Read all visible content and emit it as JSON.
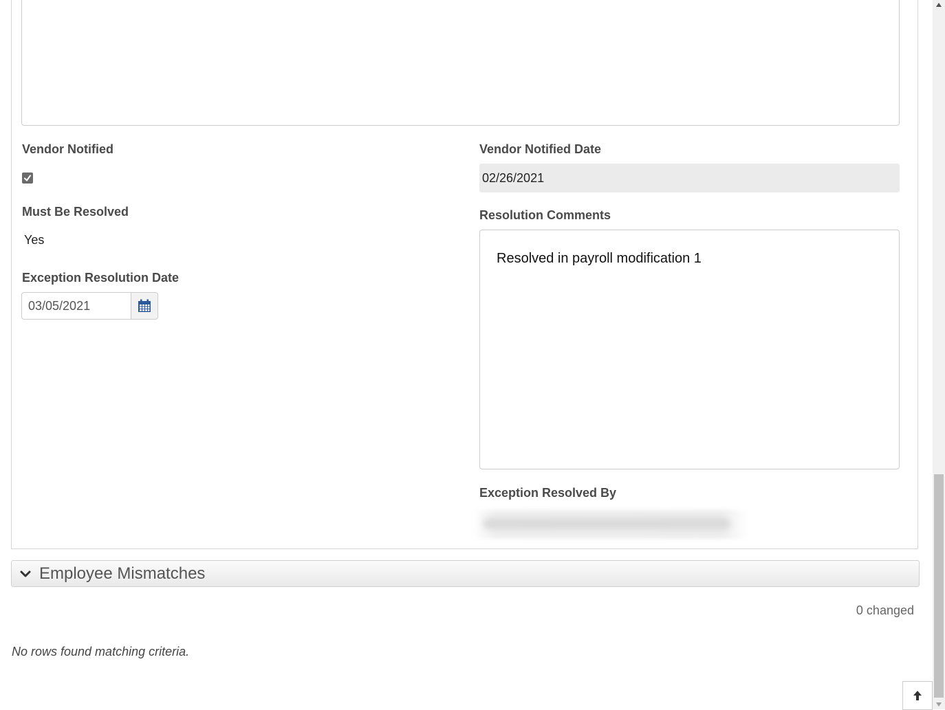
{
  "form": {
    "vendor_notified_label": "Vendor Notified",
    "vendor_notified_checked": true,
    "vendor_notified_date_label": "Vendor Notified Date",
    "vendor_notified_date_value": "02/26/2021",
    "must_be_resolved_label": "Must Be Resolved",
    "must_be_resolved_value": "Yes",
    "resolution_comments_label": "Resolution Comments",
    "resolution_comments_value": "Resolved in payroll modification 1",
    "exception_resolution_date_label": "Exception Resolution Date",
    "exception_resolution_date_value": "03/05/2021",
    "exception_resolved_by_label": "Exception Resolved By"
  },
  "section": {
    "title": "Employee Mismatches",
    "changed_text": "0 changed",
    "empty_text": "No rows found matching criteria."
  },
  "icons": {
    "calendar": "calendar-icon",
    "chevron": "chevron-down-icon",
    "scroll_top": "arrow-up-icon"
  },
  "colors": {
    "calendar_icon": "#2a5a9c",
    "label_text": "#4a4a4a",
    "readonly_bg": "#ebebeb"
  }
}
